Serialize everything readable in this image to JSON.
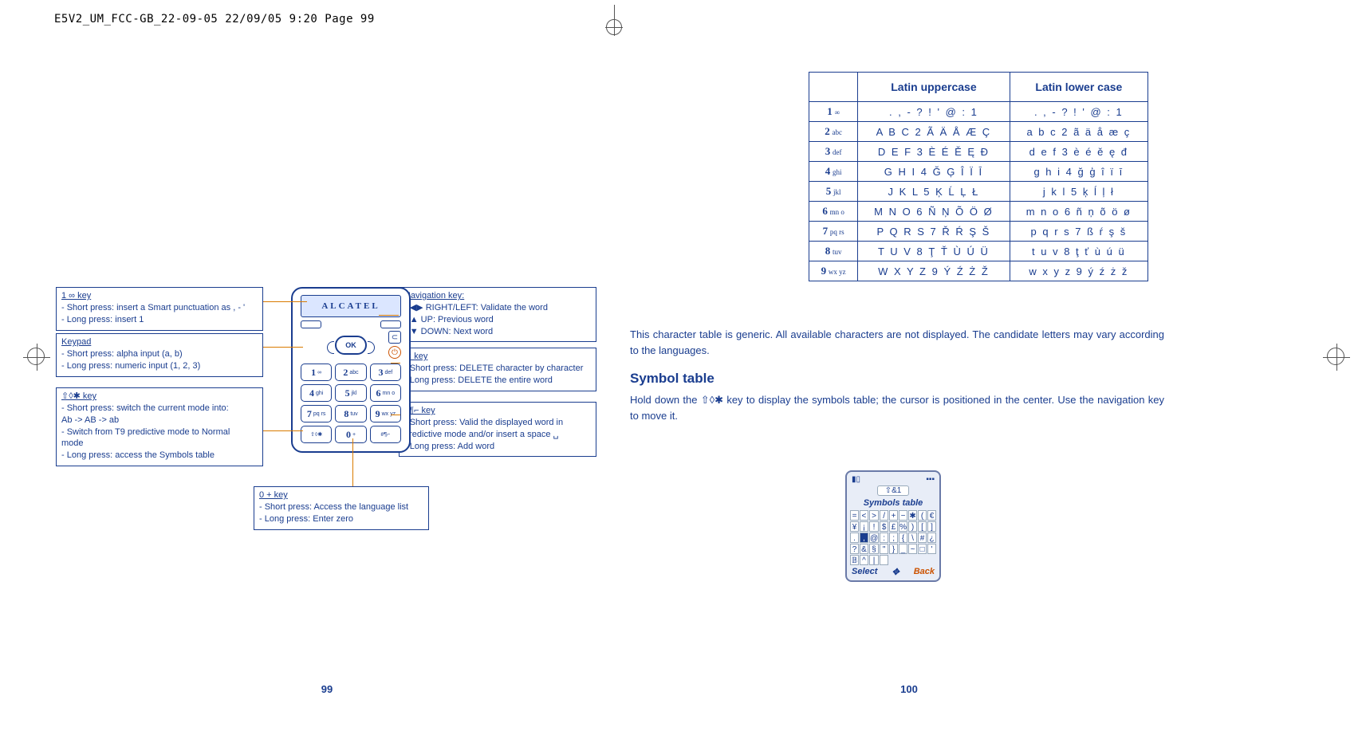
{
  "header": "E5V2_UM_FCC-GB_22-09-05  22/09/05  9:20  Page 99",
  "phone": {
    "brand": "ALCATEL",
    "ok": "OK",
    "c": "⊂",
    "pwr": "⏻",
    "keys": {
      "k1": {
        "d": "1",
        "s": "∞"
      },
      "k2": {
        "d": "2",
        "s": "abc"
      },
      "k3": {
        "d": "3",
        "s": "def"
      },
      "k4": {
        "d": "4",
        "s": "ghi"
      },
      "k5": {
        "d": "5",
        "s": "jkl"
      },
      "k6": {
        "d": "6",
        "s": "mn o"
      },
      "k7": {
        "d": "7",
        "s": "pq rs"
      },
      "k8": {
        "d": "8",
        "s": "tuv"
      },
      "k9": {
        "d": "9",
        "s": "wx yz"
      },
      "kstar": {
        "d": "",
        "s": "⇧◊✱"
      },
      "k0": {
        "d": "0",
        "s": "+"
      },
      "khash": {
        "d": "",
        "s": "#¶⌐"
      }
    }
  },
  "callouts": {
    "c1": {
      "title": "1 ∞  key",
      "l1": "-  Short press: insert a Smart punctuation as , - '",
      "l2": "-  Long press: insert 1"
    },
    "c2": {
      "title": "Keypad",
      "l1": "-  Short press: alpha input (a, b)",
      "l2": "-  Long press: numeric input (1, 2, 3)"
    },
    "c3": {
      "title": "⇧◊✱  key",
      "l1": "-  Short press: switch the current mode into:",
      "l1b": "   Ab -> AB -> ab",
      "l2": "-  Switch from T9 predictive mode to Normal",
      "l2b": "   mode",
      "l3": "-  Long press: access the Symbols table"
    },
    "c4": {
      "title": "Navigation key:",
      "l1": "-  ◀▶  RIGHT/LEFT: Validate the word",
      "l2": "-  ▲  UP: Previous word",
      "l3": "-  ▼  DOWN: Next word"
    },
    "c5": {
      "title": "⊂  key",
      "l1": "-  Short press: DELETE character by character",
      "l2": "-  Long press: DELETE the entire word"
    },
    "c6": {
      "title": "#¶⌐  key",
      "l1": "-  Short press: Valid the displayed word in",
      "l1b": "   predictive mode and/or insert a space  ␣",
      "l2": "-  Long press: Add word"
    },
    "c7": {
      "title": "0  +  key",
      "l1": "-  Short press: Access the language list",
      "l2": "-  Long press: Enter zero"
    }
  },
  "page_left_num": "99",
  "page_right_num": "100",
  "table": {
    "h1": "Latin uppercase",
    "h2": "Latin lower case",
    "rows": [
      {
        "k": {
          "d": "1",
          "s": "∞"
        },
        "u": ". , - ? ! ' @ : 1",
        "l": ". , - ? ! ' @ : 1"
      },
      {
        "k": {
          "d": "2",
          "s": "abc"
        },
        "u": "A B C 2 Ã Ä Å Æ Ç",
        "l": "a b c 2 ã ä å æ ç"
      },
      {
        "k": {
          "d": "3",
          "s": "def"
        },
        "u": "D E F 3 È É Ě Ę Đ",
        "l": "d e f 3 è é ě ę đ"
      },
      {
        "k": {
          "d": "4",
          "s": "ghi"
        },
        "u": "G H I 4 Ğ Ģ Î Ï Ī",
        "l": "g h i 4 ğ ģ î ï ī"
      },
      {
        "k": {
          "d": "5",
          "s": "jkl"
        },
        "u": "J K L 5 Ķ Ĺ Ļ Ł",
        "l": "j k l 5 ķ ĺ ļ ł"
      },
      {
        "k": {
          "d": "6",
          "s": "mn o"
        },
        "u": "M N O 6 Ñ Ņ Õ Ö Ø",
        "l": "m n o 6 ñ ņ õ ö ø"
      },
      {
        "k": {
          "d": "7",
          "s": "pq rs"
        },
        "u": "P Q R S 7 Ř Ŕ Ş Š",
        "l": "p q r s 7 ß ŕ ş š"
      },
      {
        "k": {
          "d": "8",
          "s": "tuv"
        },
        "u": "T U V 8 Ţ Ť Ù Ú Ü",
        "l": "t u v 8 ţ ť ù ú ü"
      },
      {
        "k": {
          "d": "9",
          "s": "wx yz"
        },
        "u": "W X Y Z 9 Ý Ź Ż Ž",
        "l": "w x y z 9 ý ź ż ž"
      }
    ]
  },
  "right_text": {
    "p1": "This character table is generic. All available characters are not displayed. The candidate letters may vary according to the languages.",
    "h": "Symbol table",
    "p2a": "Hold down the ",
    "p2key": "⇧◊✱",
    "p2b": " key to display the symbols table; the cursor is positioned in the center. Use the navigation key to move it."
  },
  "symbols": {
    "title": "Symbols table",
    "mode": "⇧&1",
    "select": "Select",
    "back": "Back",
    "bat": "▮▯",
    "sig": "▪▪▪",
    "grid": [
      "=",
      "<",
      ">",
      "/",
      "+",
      "−",
      "✱",
      "(",
      "€",
      "¥",
      "¡",
      "!",
      "$",
      "£",
      "%",
      ")",
      "[",
      "]",
      ".",
      ",",
      "@",
      ":",
      ";",
      "{",
      "\\",
      "#",
      "¿",
      "?",
      "&",
      "§",
      "\"",
      "}",
      "_",
      "~",
      "□",
      "'",
      "𝔹",
      "^",
      "|",
      " "
    ],
    "sel_index": 19
  }
}
